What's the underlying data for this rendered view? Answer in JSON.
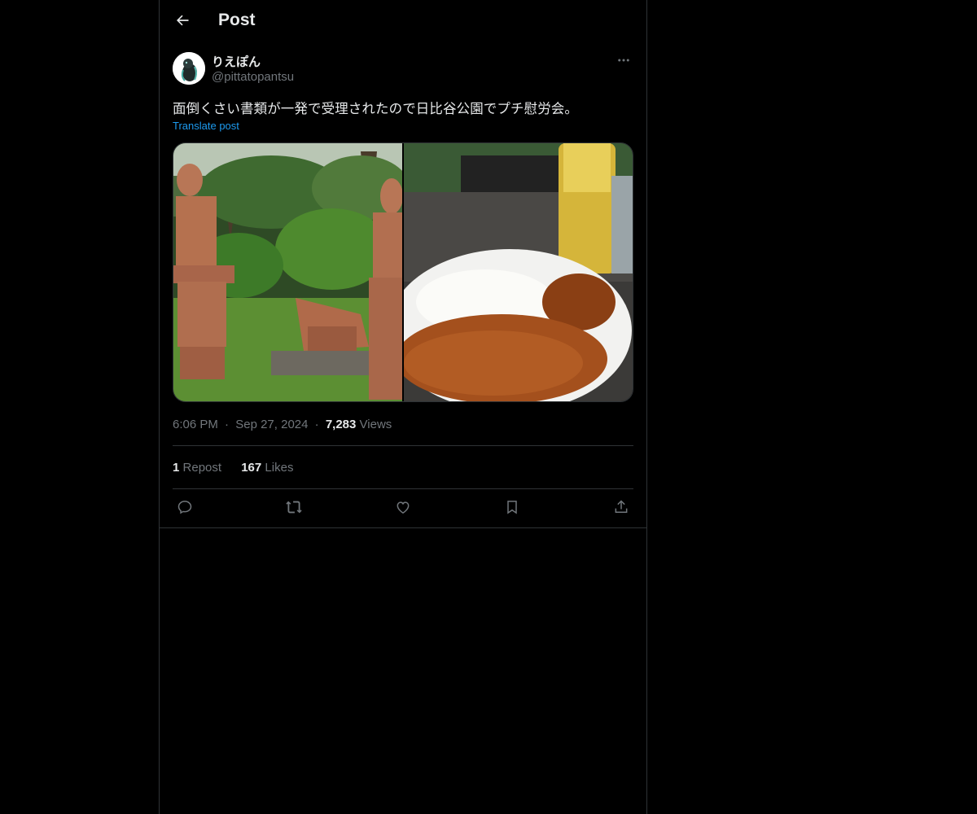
{
  "header": {
    "title": "Post",
    "back_icon": "arrow-left-icon"
  },
  "author": {
    "display_name": "りえぽん",
    "handle": "@pittatopantsu",
    "more_icon": "more-horizontal-icon"
  },
  "post": {
    "text": "面倒くさい書類が一発で受理されたので日比谷公園でプチ慰労会。",
    "translate_label": "Translate post"
  },
  "meta": {
    "time": "6:06 PM",
    "date": "Sep 27, 2024",
    "views_count": "7,283",
    "views_label": "Views",
    "separator": "·"
  },
  "stats": {
    "reposts_count": "1",
    "reposts_label": "Repost",
    "likes_count": "167",
    "likes_label": "Likes"
  },
  "actions": [
    "reply-icon",
    "repost-icon",
    "like-icon",
    "bookmark-icon",
    "share-icon"
  ],
  "colors": {
    "background": "#000000",
    "text": "#e7e9ea",
    "muted": "#71767b",
    "link": "#1d9bf0",
    "border": "#2f3336"
  }
}
